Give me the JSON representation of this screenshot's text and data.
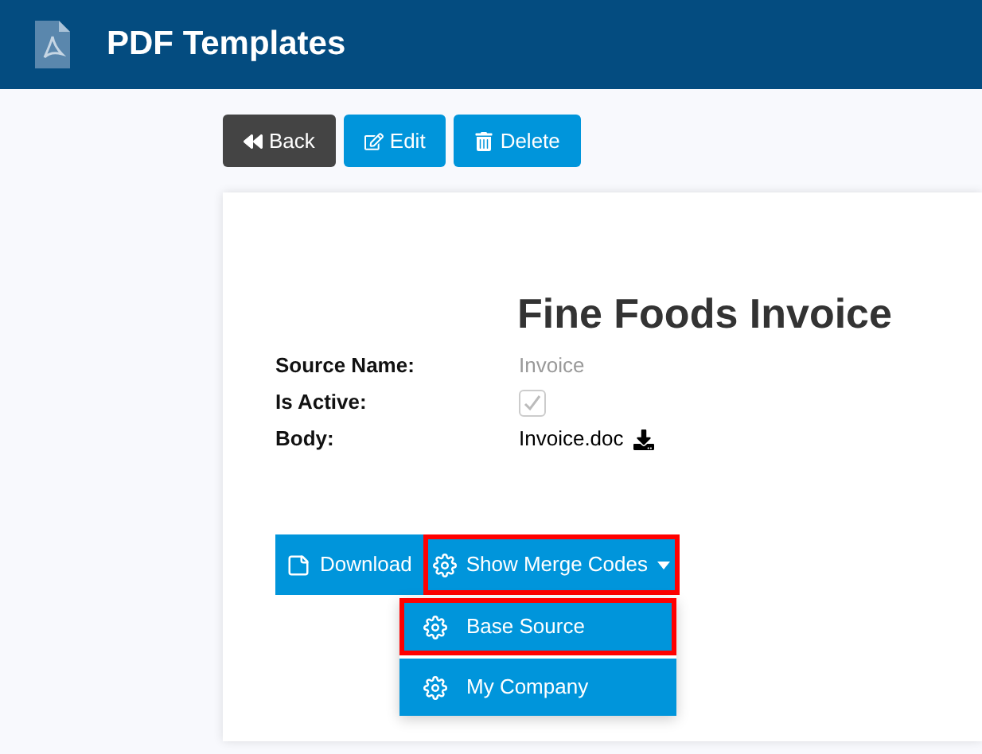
{
  "header": {
    "title": "PDF Templates"
  },
  "toolbar": [
    {
      "label": "Back",
      "kind": "back"
    },
    {
      "label": "Edit",
      "kind": "edit"
    },
    {
      "label": "Delete",
      "kind": "delete"
    }
  ],
  "card": {
    "title": "Fine Foods Invoice",
    "fields": [
      {
        "label": "Source Name:",
        "kind": "text",
        "value": "Invoice"
      },
      {
        "label": "Is Active:",
        "kind": "checkbox",
        "checked": true
      },
      {
        "label": "Body:",
        "kind": "file",
        "value": "Invoice.doc"
      }
    ],
    "download_button": {
      "label": "Download"
    },
    "merge_button": {
      "label": "Show Merge Codes",
      "expanded": true,
      "highlighted": true
    },
    "menu": [
      {
        "label": "Base Source",
        "highlighted": true
      },
      {
        "label": "My Company",
        "highlighted": false
      }
    ]
  }
}
